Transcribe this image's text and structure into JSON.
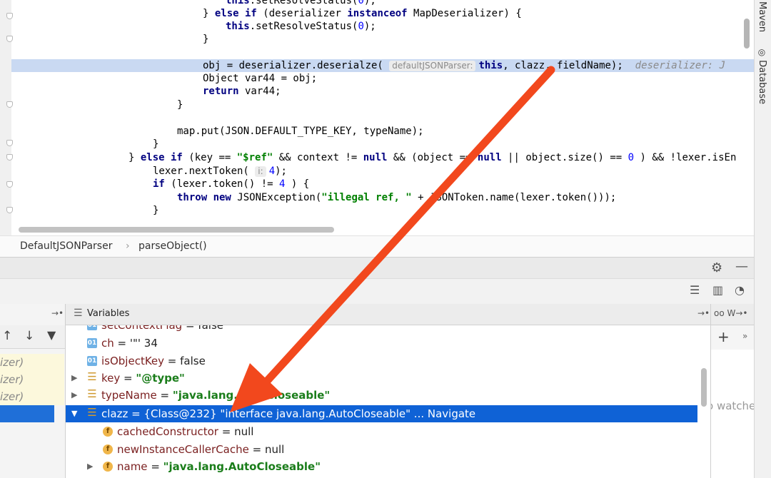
{
  "editor": {
    "lines": [
      {
        "id": "l0",
        "indent": "        ",
        "segments": [
          [
            "kw",
            "this"
          ],
          [
            "",
            "."
          ],
          [
            "",
            "setResolveStatus("
          ],
          [
            "num",
            "0"
          ],
          [
            "",
            ");"
          ]
        ]
      },
      {
        "id": "l1",
        "indent": "    ",
        "segments": [
          [
            "",
            "} "
          ],
          [
            "kw",
            "else if"
          ],
          [
            "",
            " (deserializer "
          ],
          [
            "kw",
            "instanceof"
          ],
          [
            "",
            " MapDeserializer) {"
          ]
        ]
      },
      {
        "id": "l2",
        "indent": "        ",
        "segments": [
          [
            "kw",
            "this"
          ],
          [
            "",
            ".setResolveStatus("
          ],
          [
            "num",
            "0"
          ],
          [
            "",
            ");"
          ]
        ]
      },
      {
        "id": "l3",
        "indent": "    ",
        "segments": [
          [
            "",
            "}"
          ]
        ]
      },
      {
        "id": "l4",
        "indent": "",
        "segments": []
      },
      {
        "id": "l5",
        "indent": "    ",
        "segments": [
          [
            "",
            "obj = deserializer.deserialze( "
          ],
          [
            "hint",
            "defaultJSONParser:"
          ],
          [
            "kw",
            "this"
          ],
          [
            "",
            ", clazz, fieldName);  "
          ],
          [
            "inlval",
            "deserializer: J"
          ]
        ]
      },
      {
        "id": "l6",
        "indent": "    ",
        "segments": [
          [
            "",
            "Object var44 = obj;"
          ]
        ]
      },
      {
        "id": "l7",
        "indent": "    ",
        "segments": [
          [
            "kw",
            "return"
          ],
          [
            "",
            " var44;"
          ]
        ]
      },
      {
        "id": "l8",
        "indent": "",
        "segments": [
          [
            "",
            "}"
          ]
        ]
      },
      {
        "id": "l9",
        "indent": "",
        "segments": []
      },
      {
        "id": "l10",
        "indent": "",
        "segments": [
          [
            "",
            "map.put(JSON.DEFAULT_TYPE_KEY, typeName);"
          ]
        ]
      },
      {
        "id": "l11",
        "indent": "",
        "segments": [
          [
            "",
            "}"
          ]
        ]
      },
      {
        "id": "l12",
        "indent": "",
        "segments": [
          [
            "",
            "} "
          ],
          [
            "kw",
            "else if"
          ],
          [
            "",
            " (key == "
          ],
          [
            "str",
            "\"$ref\""
          ],
          [
            "",
            " && context != "
          ],
          [
            "kw",
            "null"
          ],
          [
            "",
            " && (object == "
          ],
          [
            "kw",
            "null"
          ],
          [
            "",
            " || object.size() == "
          ],
          [
            "num",
            "0"
          ],
          [
            "",
            " ) && !lexer.isEn"
          ]
        ]
      },
      {
        "id": "l13",
        "indent": "",
        "segments": [
          [
            "",
            "lexer.nextToken( "
          ],
          [
            "hint",
            "i:"
          ],
          [
            "num",
            "4"
          ],
          [
            "",
            ");"
          ]
        ]
      },
      {
        "id": "l14",
        "indent": "",
        "segments": [
          [
            "kw",
            "if"
          ],
          [
            "",
            " (lexer.token() != "
          ],
          [
            "num",
            "4"
          ],
          [
            "",
            " ) {"
          ]
        ]
      },
      {
        "id": "l15",
        "indent": "",
        "segments": [
          [
            "kw",
            "throw new"
          ],
          [
            "",
            " JSONException("
          ],
          [
            "str",
            "\"illegal ref, \""
          ],
          [
            "",
            " + JSONToken.name(lexer.token()));"
          ]
        ]
      },
      {
        "id": "l16",
        "indent": "",
        "segments": [
          [
            "",
            "}"
          ]
        ]
      }
    ]
  },
  "right_strip": {
    "maven_label": "Maven",
    "database_label": "Database"
  },
  "breadcrumb": {
    "class_name": "DefaultJSONParser",
    "method_name": "parseObject()",
    "separator": "›"
  },
  "debugger": {
    "variables_title": "Variables",
    "frames": [
      "izer)",
      "izer)",
      "izer)",
      ""
    ],
    "watches_message": "o watche",
    "variables": [
      {
        "icon": "prim",
        "name": "setContextFlag",
        "eq": " = ",
        "value": "false",
        "value_kind": "plain",
        "expandable": false,
        "selected": false
      },
      {
        "icon": "prim",
        "name": "ch",
        "eq": " = ",
        "value": "'\"' 34",
        "value_kind": "plain",
        "expandable": false,
        "selected": false
      },
      {
        "icon": "prim",
        "name": "isObjectKey",
        "eq": " = ",
        "value": "false",
        "value_kind": "plain",
        "expandable": false,
        "selected": false
      },
      {
        "icon": "obj",
        "name": "key",
        "eq": " = ",
        "value": "\"@type\"",
        "value_kind": "string",
        "expandable": true,
        "selected": false
      },
      {
        "icon": "obj",
        "name": "typeName",
        "eq": " = ",
        "value": "\"java.lang.AutoCloseable\"",
        "value_kind": "string",
        "expandable": true,
        "selected": false
      },
      {
        "icon": "obj",
        "name": "clazz",
        "eq": " = ",
        "value": "{Class@232} \"interface java.lang.AutoCloseable\" ... Navigate",
        "value_kind": "plain",
        "expandable": true,
        "expanded": true,
        "selected": true
      },
      {
        "icon": "fld",
        "name": "cachedConstructor",
        "eq": " = ",
        "value": "null",
        "value_kind": "plain",
        "expandable": false,
        "selected": false,
        "child": true
      },
      {
        "icon": "fld",
        "name": "newInstanceCallerCache",
        "eq": " = ",
        "value": "null",
        "value_kind": "plain",
        "expandable": false,
        "selected": false,
        "child": true
      },
      {
        "icon": "fld",
        "name": "name",
        "eq": " = ",
        "value": "\"java.lang.AutoCloseable\"",
        "value_kind": "string",
        "expandable": true,
        "selected": false,
        "child": true
      }
    ]
  },
  "annotation": {
    "arrow_color": "#f2481d"
  }
}
